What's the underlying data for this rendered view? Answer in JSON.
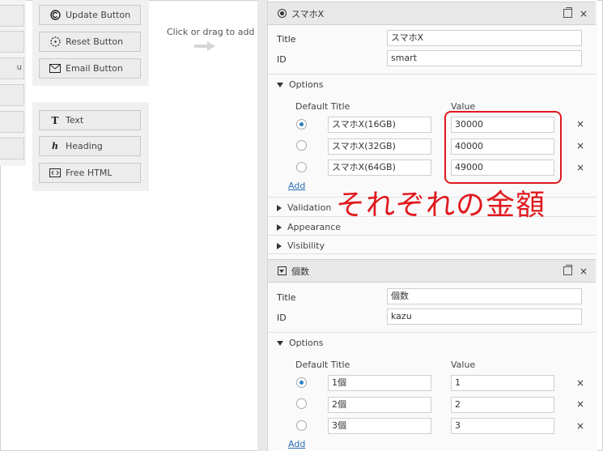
{
  "toolbar": {
    "group1": [
      {
        "label": "Update Button",
        "icon": "c-circle-icon"
      },
      {
        "label": "Reset Button",
        "icon": "reset-icon"
      },
      {
        "label": "Email Button",
        "icon": "envelope-icon"
      }
    ],
    "group2": [
      {
        "label": "Text",
        "icon": "text-t-icon"
      },
      {
        "label": "Heading",
        "icon": "heading-h-icon"
      },
      {
        "label": "Free HTML",
        "icon": "code-icon"
      }
    ],
    "left_stub_text": "u"
  },
  "canvas": {
    "hint": "Click or drag to add"
  },
  "panel1": {
    "header": "スマホX",
    "title_label": "Title",
    "title_value": "スマホX",
    "id_label": "ID",
    "id_value": "smart",
    "options_label": "Options",
    "col_default_title": "Default Title",
    "col_value": "Value",
    "options": [
      {
        "title": "スマホX(16GB)",
        "value": "30000",
        "selected": true
      },
      {
        "title": "スマホX(32GB)",
        "value": "40000",
        "selected": false
      },
      {
        "title": "スマホX(64GB)",
        "value": "49000",
        "selected": false
      }
    ],
    "add_label": "Add",
    "sections": [
      "Validation",
      "Appearance",
      "Visibility"
    ]
  },
  "panel2": {
    "header": "個数",
    "title_label": "Title",
    "title_value": "個数",
    "id_label": "ID",
    "id_value": "kazu",
    "options_label": "Options",
    "col_default_title": "Default Title",
    "col_value": "Value",
    "options": [
      {
        "title": "1個",
        "value": "1",
        "selected": true
      },
      {
        "title": "2個",
        "value": "2",
        "selected": false
      },
      {
        "title": "3個",
        "value": "3",
        "selected": false
      }
    ],
    "add_label": "Add"
  },
  "delete_symbol": "×",
  "annotation": "それぞれの金額",
  "colors": {
    "annotation_red": "#e0191e",
    "link_blue": "#2a6fb5",
    "radio_blue": "#2a7fc0"
  }
}
